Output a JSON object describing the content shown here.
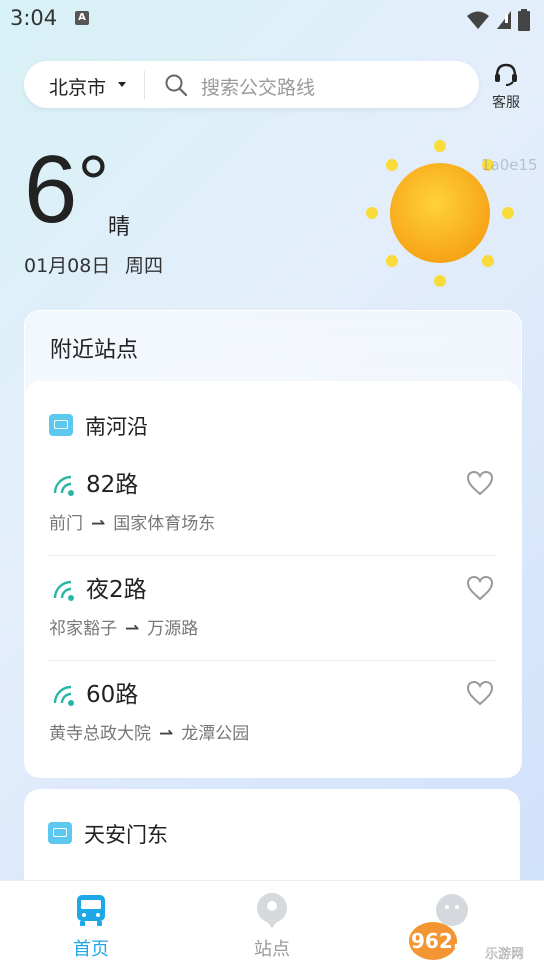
{
  "status_bar": {
    "time": "3:04",
    "app_badge": "A"
  },
  "search": {
    "city": "北京市",
    "placeholder": "搜索公交路线"
  },
  "service": {
    "label": "客服",
    "icon": "headset-icon"
  },
  "weather": {
    "temperature": "6",
    "degree": "°",
    "condition": "晴",
    "date": "01月08日",
    "weekday": "周四",
    "icon": "sun-icon",
    "overlay_code": "1a0e15"
  },
  "nearby": {
    "title": "附近站点",
    "stations": [
      {
        "name": "南河沿",
        "routes": [
          {
            "name": "82路",
            "from": "前门",
            "to": "国家体育场东"
          },
          {
            "name": "夜2路",
            "from": "祁家豁子",
            "to": "万源路"
          },
          {
            "name": "60路",
            "from": "黄寺总政大院",
            "to": "龙潭公园"
          }
        ]
      },
      {
        "name": "天安门东",
        "routes": []
      }
    ]
  },
  "bottom_nav": {
    "items": [
      {
        "label": "首页",
        "icon": "bus-icon",
        "active": true
      },
      {
        "label": "站点",
        "icon": "location-pin-icon",
        "active": false
      },
      {
        "label": "",
        "icon": "profile-icon",
        "active": false
      }
    ]
  },
  "watermark": {
    "brand": "962.NET",
    "sub": "乐游网"
  },
  "colors": {
    "accent": "#1fa8e8",
    "route_icon": "#2bb5a6",
    "heart": "#999999",
    "sun": "#f8b320"
  }
}
